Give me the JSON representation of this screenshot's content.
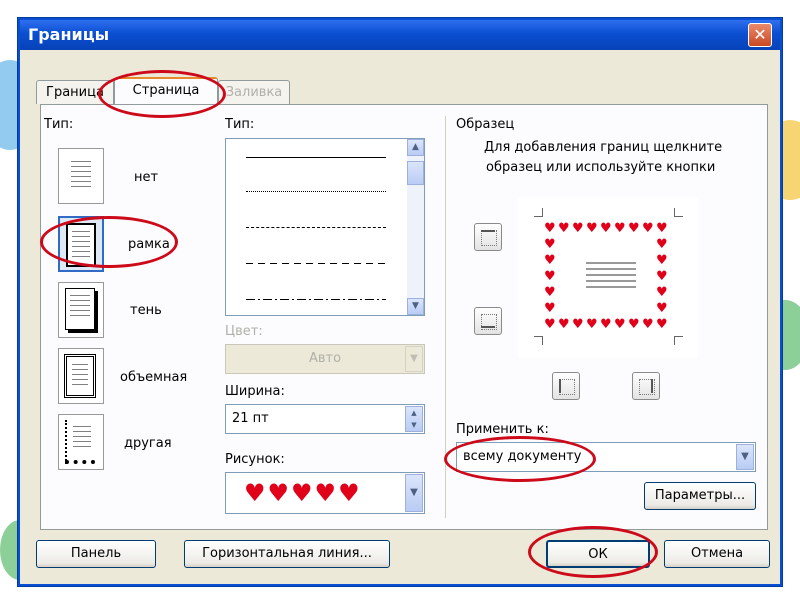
{
  "window": {
    "title": "Границы",
    "close_glyph": "✕"
  },
  "tabs": [
    {
      "label": "Граница",
      "state": "normal"
    },
    {
      "label": "Страница",
      "state": "active"
    },
    {
      "label": "Заливка",
      "state": "disabled"
    }
  ],
  "type_section": {
    "label": "Тип:",
    "items": [
      {
        "label": "нет",
        "icon": "page-no-border-icon"
      },
      {
        "label": "рамка",
        "icon": "page-box-border-icon",
        "selected": true
      },
      {
        "label": "тень",
        "icon": "page-shadow-border-icon"
      },
      {
        "label": "объемная",
        "icon": "page-3d-border-icon"
      },
      {
        "label": "другая",
        "icon": "page-custom-border-icon"
      }
    ]
  },
  "style_section": {
    "label": "Тип:",
    "line_styles": [
      "solid",
      "dotted",
      "dashed",
      "long-dash",
      "dash-dot"
    ],
    "color_label": "Цвет:",
    "color_value": "Авто",
    "width_label": "Ширина:",
    "width_value": "21 пт",
    "art_label": "Рисунок:",
    "art_icon": "hearts-art-icon"
  },
  "preview_section": {
    "label": "Образец",
    "hint_line1": "Для добавления границ щелкните",
    "hint_line2": "образец или используйте кнопки",
    "apply_label": "Применить к:",
    "apply_value": "всему документу",
    "options_button": "Параметры..."
  },
  "buttons": {
    "panel": "Панель",
    "horizontal_line": "Горизонтальная линия...",
    "ok": "ОК",
    "cancel": "Отмена"
  },
  "colors": {
    "accent": "#0a4fd1",
    "highlight_oval": "#cc0a1a",
    "heart": "#e0001a"
  }
}
